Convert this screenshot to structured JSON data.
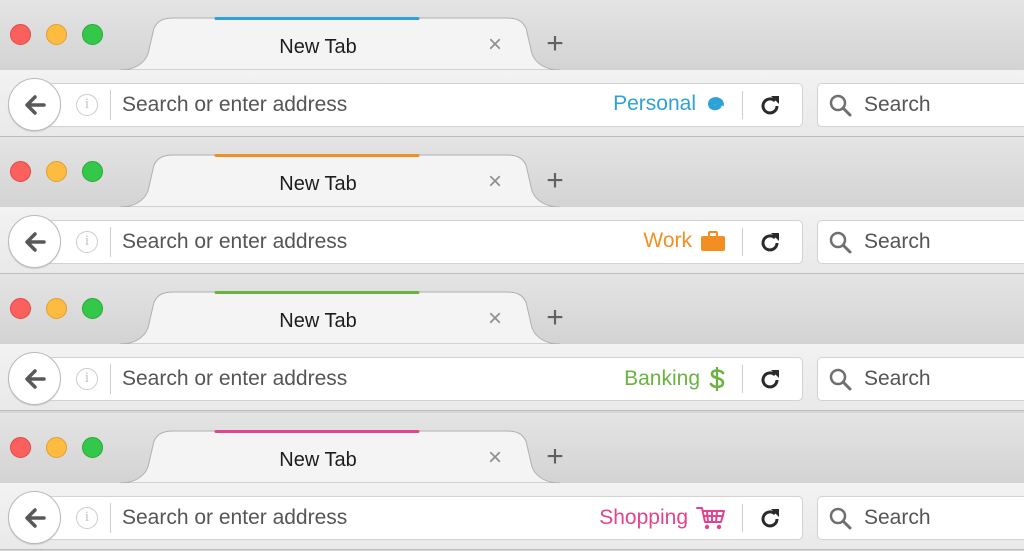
{
  "windows": [
    {
      "tab": {
        "title": "New Tab",
        "close": "×"
      },
      "newtab": "+",
      "url_placeholder": "Search or enter address",
      "container": {
        "label": "Personal",
        "icon": "fingerprint-icon",
        "color": "#2ea2d7"
      },
      "search_placeholder": "Search"
    },
    {
      "tab": {
        "title": "New Tab",
        "close": "×"
      },
      "newtab": "+",
      "url_placeholder": "Search or enter address",
      "container": {
        "label": "Work",
        "icon": "briefcase-icon",
        "color": "#f38f22"
      },
      "search_placeholder": "Search"
    },
    {
      "tab": {
        "title": "New Tab",
        "close": "×"
      },
      "newtab": "+",
      "url_placeholder": "Search or enter address",
      "container": {
        "label": "Banking",
        "icon": "dollar-icon",
        "color": "#6ab340"
      },
      "search_placeholder": "Search"
    },
    {
      "tab": {
        "title": "New Tab",
        "close": "×"
      },
      "newtab": "+",
      "url_placeholder": "Search or enter address",
      "container": {
        "label": "Shopping",
        "icon": "cart-icon",
        "color": "#e3448e"
      },
      "search_placeholder": "Search"
    }
  ]
}
